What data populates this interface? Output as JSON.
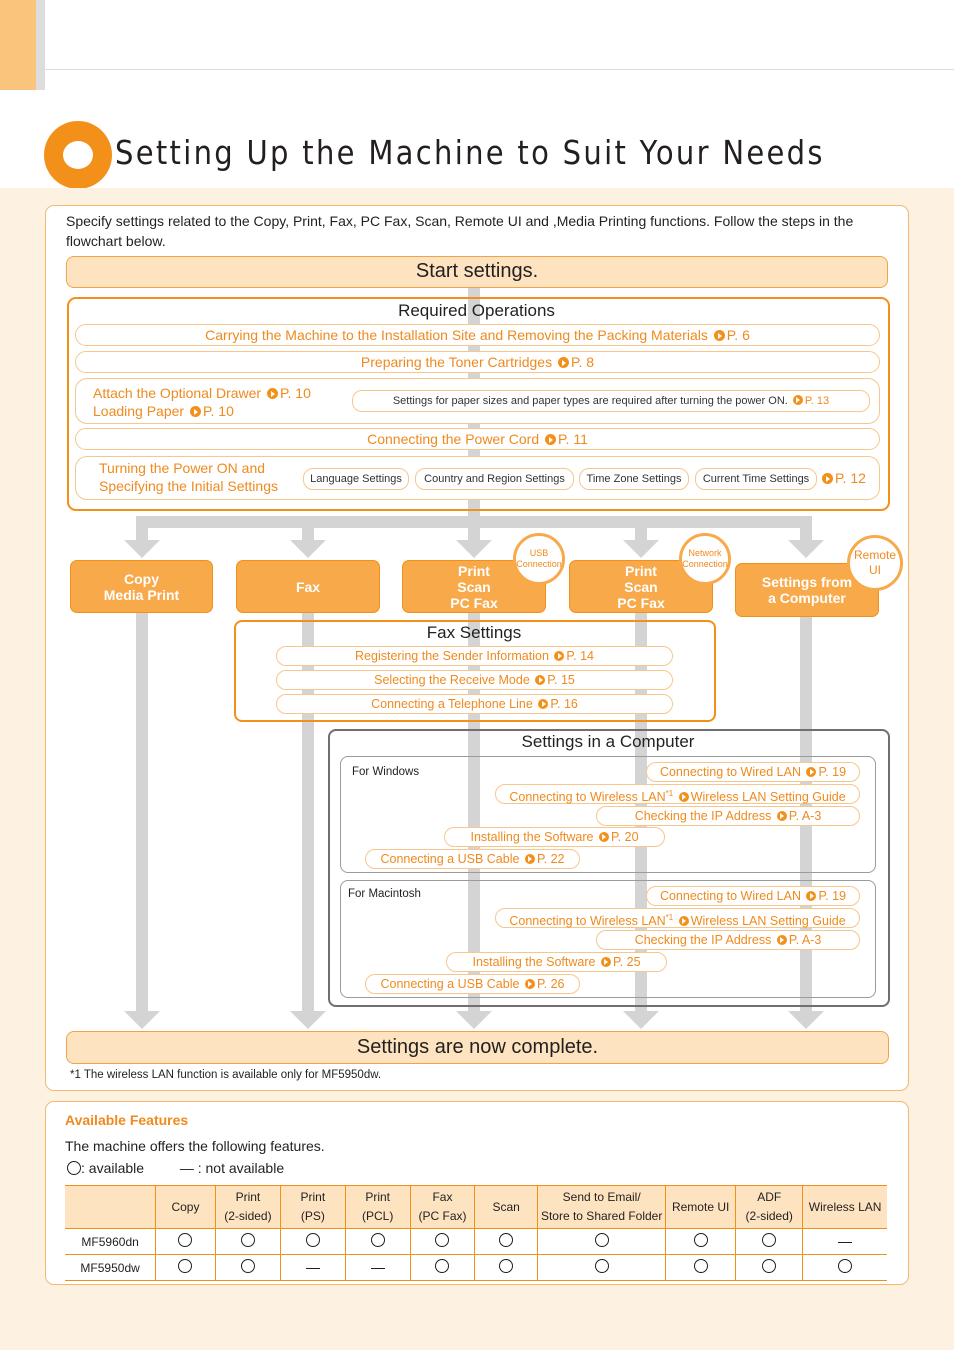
{
  "page": {
    "title": "Setting Up the Machine to Suit Your Needs"
  },
  "colors": {
    "accent": "#f39019",
    "box_fill": "#f8a94a",
    "band_bg": "#fdf1e2",
    "bar_fill": "#fde3c0",
    "arrow_gray": "#d4d4d4"
  },
  "intro": "Specify settings related to the Copy, Print, Fax, PC Fax, Scan, Remote UI and ,Media Printing functions. Follow the steps in the flowchart below.",
  "start": "Start settings.",
  "required": {
    "title": "Required Operations",
    "carry": {
      "label": "Carrying the Machine to the Installation Site and Removing the Packing Materials",
      "page": "P. 6"
    },
    "toner": {
      "label": "Preparing the Toner Cartridges",
      "page": "P. 8"
    },
    "drawer": {
      "label": "Attach the Optional Drawer",
      "page": "P. 10"
    },
    "paper": {
      "label": "Loading Paper",
      "page": "P. 10"
    },
    "paper_note": {
      "label": "Settings for paper sizes and paper types are required after turning the power ON.",
      "page": "P. 13"
    },
    "power_cord": {
      "label": "Connecting the Power Cord",
      "page": "P. 11"
    },
    "power_on": {
      "line1": "Turning the Power ON and",
      "line2": "Specifying the Initial Settings",
      "page": "P. 12"
    },
    "initial_settings": [
      "Language Settings",
      "Country and Region Settings",
      "Time Zone Settings",
      "Current Time Settings"
    ]
  },
  "categories": [
    {
      "lines": [
        "Copy",
        "Media Print"
      ]
    },
    {
      "lines": [
        "Fax"
      ]
    },
    {
      "lines": [
        "Print",
        "Scan",
        "PC Fax"
      ],
      "badge": [
        "USB",
        "Connection"
      ]
    },
    {
      "lines": [
        "Print",
        "Scan",
        "PC Fax"
      ],
      "badge": [
        "Network",
        "Connection"
      ]
    },
    {
      "lines": [
        "Settings from",
        "a Computer"
      ],
      "badge": [
        "Remote",
        "UI"
      ]
    }
  ],
  "fax": {
    "title": "Fax Settings",
    "items": [
      {
        "label": "Registering the Sender Information",
        "page": "P. 14"
      },
      {
        "label": "Selecting the Receive Mode",
        "page": "P. 15"
      },
      {
        "label": "Connecting a Telephone Line",
        "page": "P. 16"
      }
    ]
  },
  "computer": {
    "title": "Settings in a Computer",
    "windows": {
      "label": "For Windows",
      "wired": {
        "label": "Connecting to Wired LAN",
        "page": "P. 19"
      },
      "wireless": {
        "label": "Connecting to Wireless LAN",
        "sup": "*1",
        "page": "Wireless LAN Setting Guide"
      },
      "ip": {
        "label": "Checking the IP Address",
        "page": "P. A-3"
      },
      "software": {
        "label": "Installing the Software",
        "page": "P. 20"
      },
      "usb": {
        "label": "Connecting a USB Cable",
        "page": "P. 22"
      }
    },
    "mac": {
      "label": "For Macintosh",
      "wired": {
        "label": "Connecting to Wired LAN",
        "page": "P. 19"
      },
      "wireless": {
        "label": "Connecting to Wireless LAN",
        "sup": "*1",
        "page": "Wireless LAN Setting Guide"
      },
      "ip": {
        "label": "Checking the IP Address",
        "page": "P. A-3"
      },
      "software": {
        "label": "Installing the Software",
        "page": "P. 25"
      },
      "usb": {
        "label": "Connecting a USB Cable",
        "page": "P. 26"
      }
    }
  },
  "complete": "Settings are now complete.",
  "footnote": "*1 The wireless LAN function is available only for MF5950dw.",
  "features": {
    "title": "Available Features",
    "description": "The machine offers the following features.",
    "legend_available": ": available",
    "legend_not_available": "— : not available",
    "columns": [
      {
        "line1": "Copy",
        "line2": ""
      },
      {
        "line1": "Print",
        "line2": "(2-sided)"
      },
      {
        "line1": "Print",
        "line2": "(PS)"
      },
      {
        "line1": "Print",
        "line2": "(PCL)"
      },
      {
        "line1": "Fax",
        "line2": "(PC Fax)"
      },
      {
        "line1": "Scan",
        "line2": ""
      },
      {
        "line1": "Send to Email/",
        "line2": "Store to Shared Folder"
      },
      {
        "line1": "Remote UI",
        "line2": ""
      },
      {
        "line1": "ADF",
        "line2": "(2-sided)"
      },
      {
        "line1": "Wireless LAN",
        "line2": ""
      }
    ],
    "rows": [
      {
        "model": "MF5960dn",
        "values": [
          "available",
          "available",
          "available",
          "available",
          "available",
          "available",
          "available",
          "available",
          "available",
          "not_available"
        ]
      },
      {
        "model": "MF5950dw",
        "values": [
          "available",
          "available",
          "not_available",
          "not_available",
          "available",
          "available",
          "available",
          "available",
          "available",
          "available"
        ]
      }
    ]
  }
}
